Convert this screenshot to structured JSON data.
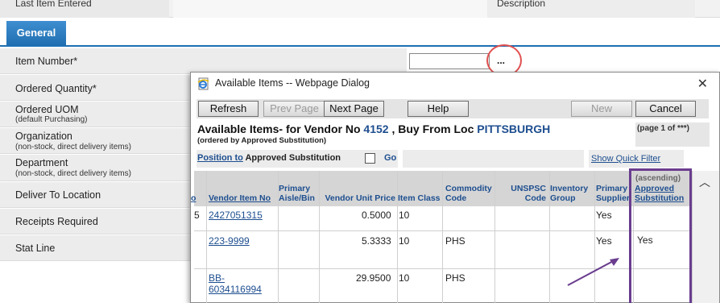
{
  "background": {
    "top_labels": [
      "Last Item Entered",
      "Description"
    ],
    "tab_general": "General",
    "rows": [
      {
        "label": "Item Number*",
        "sub": ""
      },
      {
        "label": "Ordered Quantity*",
        "sub": ""
      },
      {
        "label": "Ordered UOM",
        "sub": "(default Purchasing)"
      },
      {
        "label": "Organization",
        "sub": "(non-stock, direct delivery items)"
      },
      {
        "label": "Department",
        "sub": "(non-stock, direct delivery items)"
      },
      {
        "label": "Deliver To Location",
        "sub": ""
      },
      {
        "label": "Receipts Required",
        "sub": ""
      },
      {
        "label": "Stat Line",
        "sub": ""
      }
    ],
    "lookup_button": "..."
  },
  "dialog": {
    "title": "Available Items -- Webpage Dialog",
    "close_glyph": "✕",
    "buttons": {
      "refresh": "Refresh",
      "prev_page": "Prev Page",
      "next_page": "Next Page",
      "help": "Help",
      "new": "New",
      "cancel": "Cancel"
    },
    "heading": {
      "prefix": "Available Items- for Vendor No",
      "vendor_no": "4152",
      "mid": ", Buy From Loc",
      "loc": "PITTSBURGH",
      "sub": "(ordered by Approved Substitution)",
      "page_info": "(page 1 of ***)"
    },
    "position": {
      "link": "Position to",
      "field": "Approved Substitution",
      "go": "Go",
      "quick_filter": "Show Quick Filter"
    },
    "columns": {
      "c0": "o",
      "vendor_item_no": "Vendor Item No",
      "primary_aisle": "Primary Aisle/Bin",
      "vendor_unit_price": "Vendor Unit Price",
      "item_class": "Item Class",
      "commodity_code": "Commodity Code",
      "unspsc_code": "UNSPSC Code",
      "inventory_group": "Inventory Group",
      "primary_supplier": "Primary Supplier",
      "approved_substitution": "Approved Substitution",
      "sort_note": "(ascending)"
    },
    "rows": [
      {
        "c0": "5",
        "vendor_item_no": "2427051315",
        "price": "0.5000",
        "item_class": "10",
        "commodity": "",
        "primary_supplier": "Yes",
        "approved_sub": ""
      },
      {
        "c0": "",
        "vendor_item_no": "223-9999",
        "price": "5.3333",
        "item_class": "10",
        "commodity": "PHS",
        "primary_supplier": "Yes",
        "approved_sub": "Yes"
      },
      {
        "c0": "",
        "vendor_item_no_line1": "BB-",
        "vendor_item_no_line2": "6034116994",
        "price": "29.9500",
        "item_class": "10",
        "commodity": "PHS",
        "primary_supplier": "",
        "approved_sub": ""
      }
    ]
  },
  "colors": {
    "tab_blue": "#1f6fb2",
    "link_blue": "#1d4e8f",
    "highlight_circle": "#e05050",
    "highlight_box": "#6a3d8f"
  }
}
